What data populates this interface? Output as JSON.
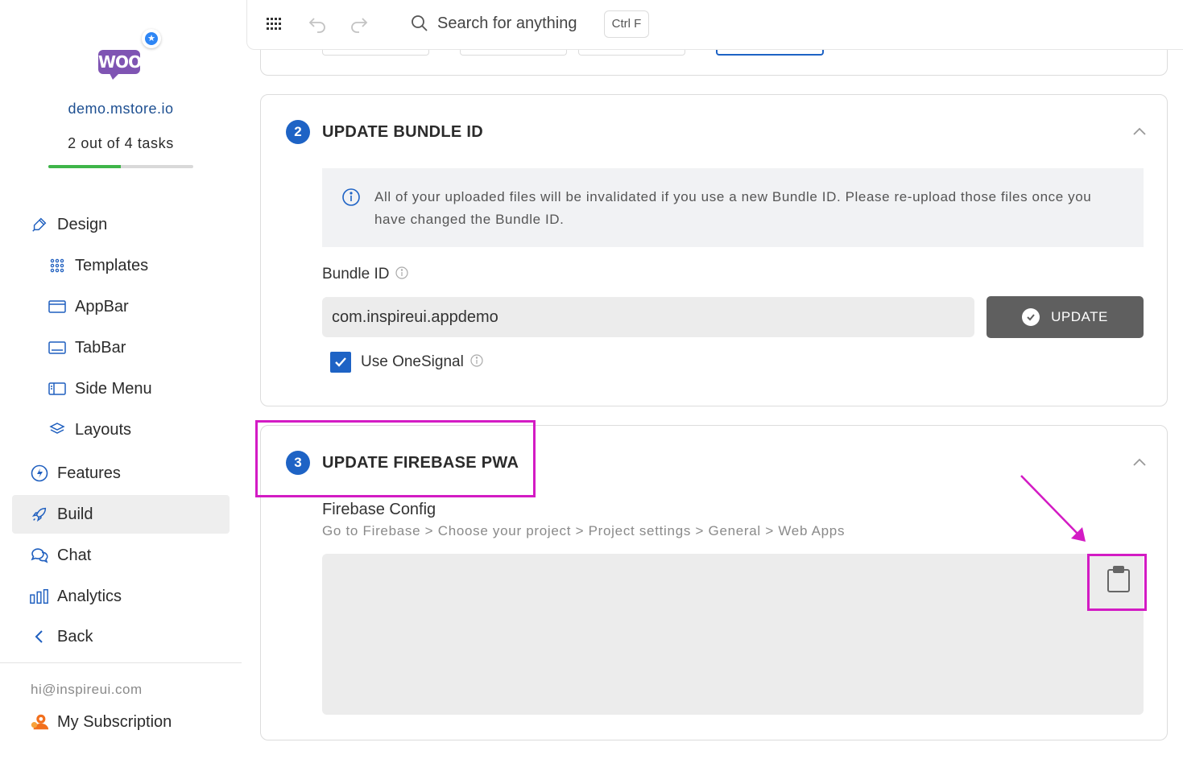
{
  "sidebar": {
    "store_name": "demo.mstore.io",
    "logo_text": "WOO",
    "tasks_text": "2 out of 4 tasks",
    "progress": {
      "completed": 2,
      "total": 4
    },
    "items": [
      {
        "label": "Design",
        "icon": "brush-icon"
      },
      {
        "label": "Templates",
        "icon": "grid-dots-icon"
      },
      {
        "label": "AppBar",
        "icon": "appbar-icon"
      },
      {
        "label": "TabBar",
        "icon": "tabbar-icon"
      },
      {
        "label": "Side Menu",
        "icon": "side-menu-icon"
      },
      {
        "label": "Layouts",
        "icon": "layers-icon"
      },
      {
        "label": "Features",
        "icon": "bolt-icon"
      },
      {
        "label": "Build",
        "icon": "rocket-icon"
      },
      {
        "label": "Chat",
        "icon": "chat-icon"
      },
      {
        "label": "Analytics",
        "icon": "bar-chart-icon"
      },
      {
        "label": "Back",
        "icon": "chevron-left-icon"
      }
    ],
    "active_item": "Build",
    "email": "hi@inspireui.com",
    "subscription_label": "My Subscription"
  },
  "topbar": {
    "search_placeholder": "Search for anything",
    "shortcut": "Ctrl F"
  },
  "bundle_section": {
    "step": "2",
    "title": "UPDATE BUNDLE ID",
    "info_text": "All of your uploaded files will be invalidated if you use a new Bundle ID. Please re-upload those files once you have changed the Bundle ID.",
    "field_label": "Bundle ID",
    "bundle_value": "com.inspireui.appdemo",
    "update_label": "UPDATE",
    "onesignal_label": "Use OneSignal",
    "onesignal_checked": true
  },
  "firebase_section": {
    "step": "3",
    "title": "UPDATE FIREBASE PWA",
    "config_label": "Firebase Config",
    "hint": "Go to Firebase > Choose your project > Project settings > General > Web Apps"
  },
  "colors": {
    "accent": "#1e63c5",
    "highlight": "#d31bc4",
    "progress": "#3eb549",
    "button": "#5f5f5f"
  }
}
